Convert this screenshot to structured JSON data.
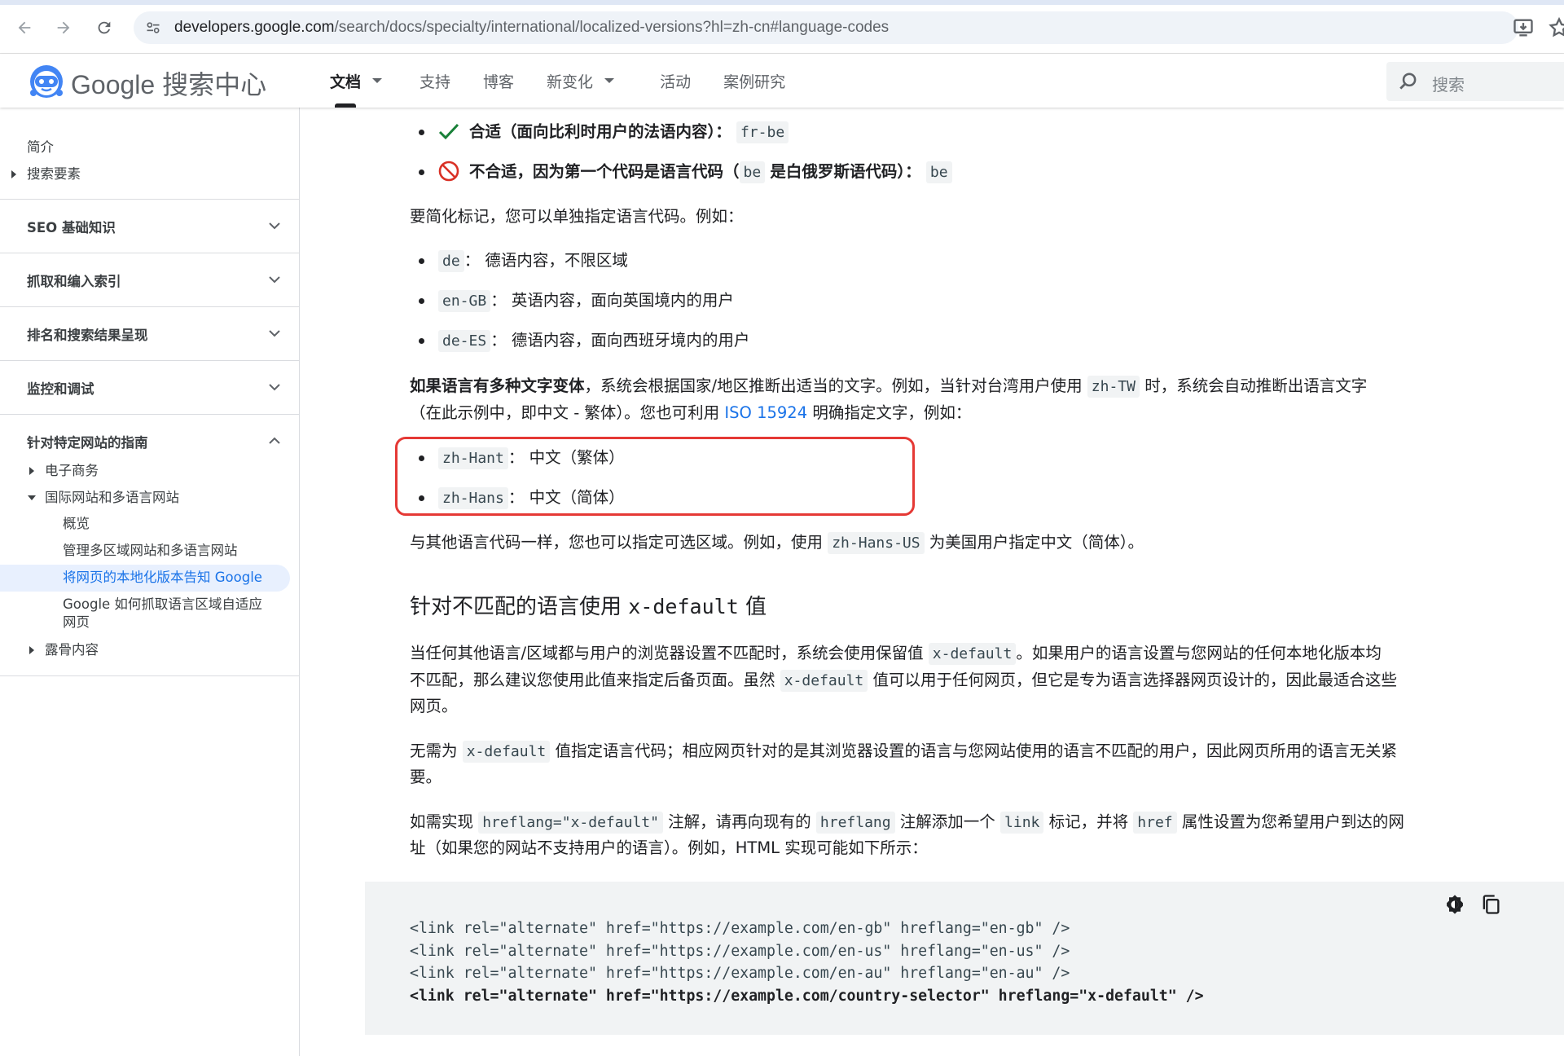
{
  "browser": {
    "url_host": "developers.google.com",
    "url_path": "/search/docs/specialty/international/localized-versions?hl=zh-cn#language-codes"
  },
  "site": {
    "logo_google": "Google",
    "logo_product": "搜索中心",
    "nav": [
      {
        "label": "文档",
        "has_dropdown": true,
        "active": true
      },
      {
        "label": "支持",
        "has_dropdown": false,
        "active": false
      },
      {
        "label": "博客",
        "has_dropdown": false,
        "active": false
      },
      {
        "label": "新变化",
        "has_dropdown": true,
        "active": false
      },
      {
        "label": "活动",
        "has_dropdown": false,
        "active": false
      },
      {
        "label": "案例研究",
        "has_dropdown": false,
        "active": false
      }
    ],
    "search_placeholder": "搜索"
  },
  "sidebar": {
    "intro": "简介",
    "search_essentials": "搜索要素",
    "sections": [
      {
        "label": "SEO 基础知识",
        "expanded": false
      },
      {
        "label": "抓取和编入索引",
        "expanded": false
      },
      {
        "label": "排名和搜索结果呈现",
        "expanded": false
      },
      {
        "label": "监控和调试",
        "expanded": false
      },
      {
        "label": "针对特定网站的指南",
        "expanded": true
      }
    ],
    "ecommerce": "电子商务",
    "international": "国际网站和多语言网站",
    "intl_children": [
      {
        "label": "概览",
        "active": false
      },
      {
        "label": "管理多区域网站和多语言网站",
        "active": false
      },
      {
        "label": "将网页的本地化版本告知 Google",
        "active": true
      },
      {
        "label": "Google 如何抓取语言区域自适应网页",
        "active": false
      }
    ],
    "explicit": "露骨内容"
  },
  "article": {
    "good_example_text": "合适（面向比利时用户的法语内容）：",
    "good_example_code": "fr-be",
    "bad_example_text_1": "不合适，因为第一个代码是语言代码（",
    "bad_example_code_1": "be",
    "bad_example_text_2": "是白俄罗斯语代码）：",
    "bad_example_code_2": "be",
    "simplify_para": "要简化标记，您可以单独指定语言代码。例如：",
    "simple_list": [
      {
        "code": "de",
        "text": "德语内容，不限区域"
      },
      {
        "code": "en-GB",
        "text": "英语内容，面向英国境内的用户"
      },
      {
        "code": "de-ES",
        "text": "德语内容，面向西班牙境内的用户"
      }
    ],
    "script_para_bold": "如果语言有多种文字变体",
    "script_para_1": "，系统会根据国家/地区推断出适当的文字。例如，当针对台湾用户使用",
    "script_para_code": "zh-TW",
    "script_para_2": "时，系统会自动推断出语言文字",
    "script_para_line2_a": "（在此示例中，即中文 - 繁体）。您也可利用",
    "script_para_link": "ISO 15924",
    "script_para_line2_b": "明确指定文字，例如：",
    "script_list": [
      {
        "code": "zh-Hant",
        "text": "中文（繁体）"
      },
      {
        "code": "zh-Hans",
        "text": "中文（简体）"
      }
    ],
    "region_para_1": "与其他语言代码一样，您也可以指定可选区域。例如，使用",
    "region_para_code": "zh-Hans-US",
    "region_para_2": "为美国用户指定中文（简体）。",
    "h2_text_1": "针对不匹配的语言使用",
    "h2_code": "x-default",
    "h2_text_2": "值",
    "xdef_para1_a": "当任何其他语言/区域都与用户的浏览器设置不匹配时，系统会使用保留值",
    "xdef_para1_code": "x-default",
    "xdef_para1_b": "。如果用户的语言设置与您网站的任何本地化版本均",
    "xdef_para1_line2_a": "不匹配，那么建议您使用此值来指定后备页面。虽然",
    "xdef_para1_line2_code": "x-default",
    "xdef_para1_line2_b": "值可以用于任何网页，但它是专为语言选择器网页设计的，因此最适合这些",
    "xdef_para1_line3": "网页。",
    "xdef_para2_a": "无需为",
    "xdef_para2_code": "x-default",
    "xdef_para2_b": "值指定语言代码；相应网页针对的是其浏览器设置的语言与您网站使用的语言不匹配的用户，因此网页所用的语言无关紧",
    "xdef_para2_line2": "要。",
    "impl_para_a": "如需实现",
    "impl_para_code1": "hreflang=\"x-default\"",
    "impl_para_b": "注解，请再向现有的",
    "impl_para_code2": "hreflang",
    "impl_para_c": "注解添加一个",
    "impl_para_code3": "link",
    "impl_para_d": "标记，并将",
    "impl_para_code4": "href",
    "impl_para_e": "属性设置为您希望用户到达的网",
    "impl_para_line2": "址（如果您的网站不支持用户的语言）。例如，HTML 实现可能如下所示：",
    "code_lines": [
      "<link rel=\"alternate\" href=\"https://example.com/en-gb\" hreflang=\"en-gb\" />",
      "<link rel=\"alternate\" href=\"https://example.com/en-us\" hreflang=\"en-us\" />",
      "<link rel=\"alternate\" href=\"https://example.com/en-au\" hreflang=\"en-au\" />"
    ],
    "code_line_bold": "<link rel=\"alternate\" href=\"https://example.com/country-selector\" hreflang=\"x-default\" />"
  }
}
